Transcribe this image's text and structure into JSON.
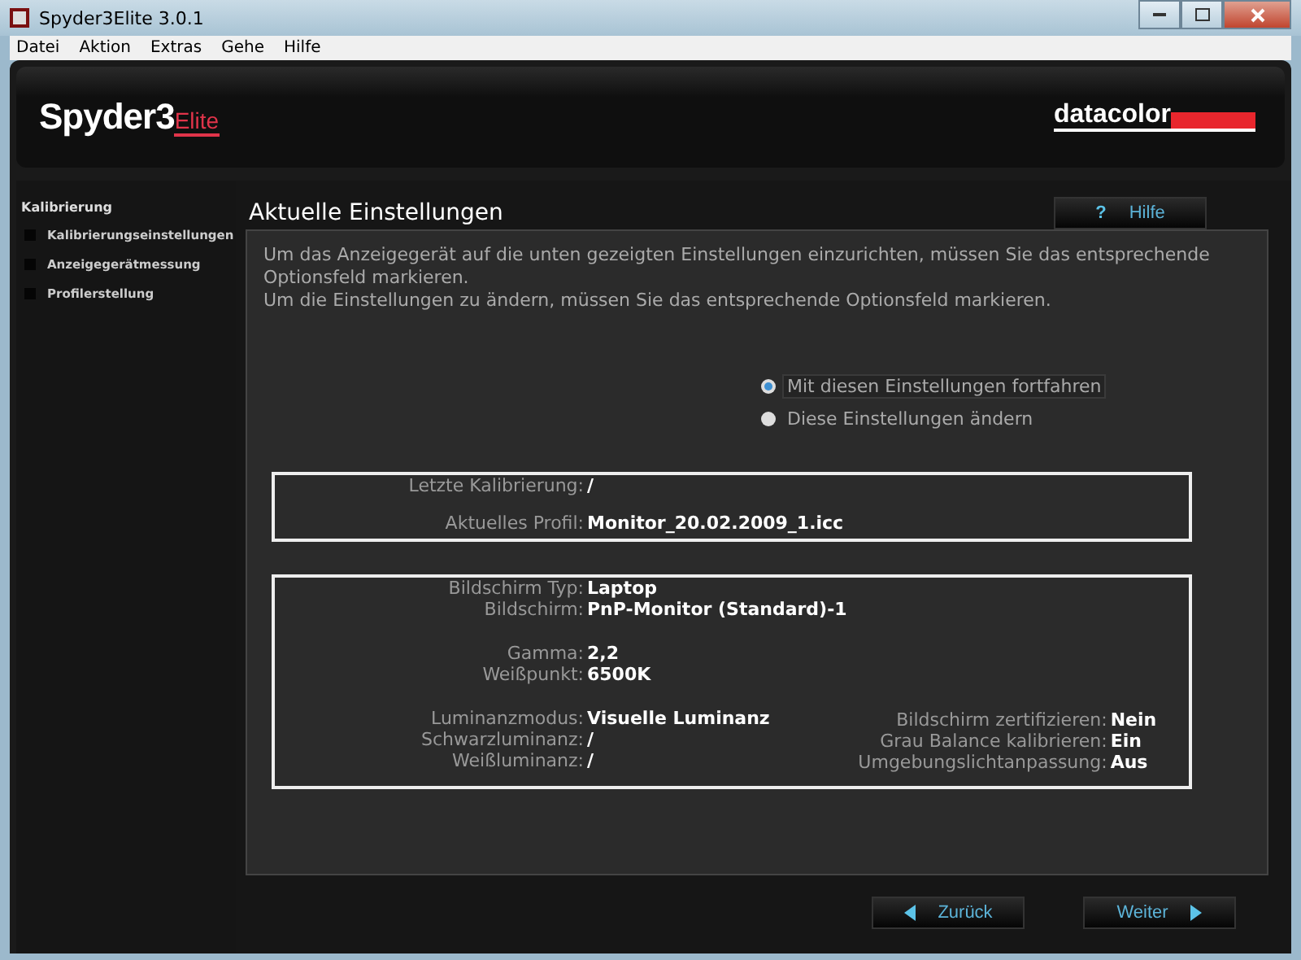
{
  "window": {
    "title": "Spyder3Elite 3.0.1"
  },
  "menu": [
    "Datei",
    "Aktion",
    "Extras",
    "Gehe",
    "Hilfe"
  ],
  "logo": {
    "main": "Spyder3",
    "sub": "Elite",
    "brand": "datacolor"
  },
  "sidebar": {
    "heading": "Kalibrierung",
    "items": [
      {
        "label": "Kalibrierungseinstellungen"
      },
      {
        "label": "Anzeigegerätmessung"
      },
      {
        "label": "Profilerstellung"
      }
    ]
  },
  "page_title": "Aktuelle Einstellungen",
  "help_button": {
    "icon": "?",
    "label": "Hilfe"
  },
  "intro": [
    "Um das Anzeigegerät auf die unten gezeigten Einstellungen einzurichten, müssen Sie das entsprechende Optionsfeld markieren.",
    "Um die Einstellungen zu ändern, müssen Sie das entsprechende Optionsfeld markieren."
  ],
  "options": [
    {
      "label": "Mit diesen Einstellungen fortfahren",
      "selected": true
    },
    {
      "label": "Diese Einstellungen ändern",
      "selected": false
    }
  ],
  "profile_box": [
    {
      "label": "Letzte Kalibrierung:",
      "value": "/"
    },
    {
      "label": "Aktuelles Profil:",
      "value": "Monitor_20.02.2009_1.icc"
    }
  ],
  "settings_box": {
    "left": [
      [
        {
          "label": "Bildschirm Typ:",
          "value": "Laptop"
        },
        {
          "label": "Bildschirm:",
          "value": "PnP-Monitor (Standard)-1"
        }
      ],
      [
        {
          "label": "Gamma:",
          "value": "2,2"
        },
        {
          "label": "Weißpunkt:",
          "value": "6500K"
        }
      ],
      [
        {
          "label": "Luminanzmodus:",
          "value": "Visuelle Luminanz"
        },
        {
          "label": "Schwarzluminanz:",
          "value": "/"
        },
        {
          "label": "Weißluminanz:",
          "value": "/"
        }
      ]
    ],
    "right": [
      {
        "label": "Bildschirm zertifizieren:",
        "value": "Nein"
      },
      {
        "label": "Grau Balance kalibrieren:",
        "value": "Ein"
      },
      {
        "label": "Umgebungslichtanpassung:",
        "value": "Aus"
      }
    ]
  },
  "nav": {
    "back": "Zurück",
    "next": "Weiter"
  }
}
